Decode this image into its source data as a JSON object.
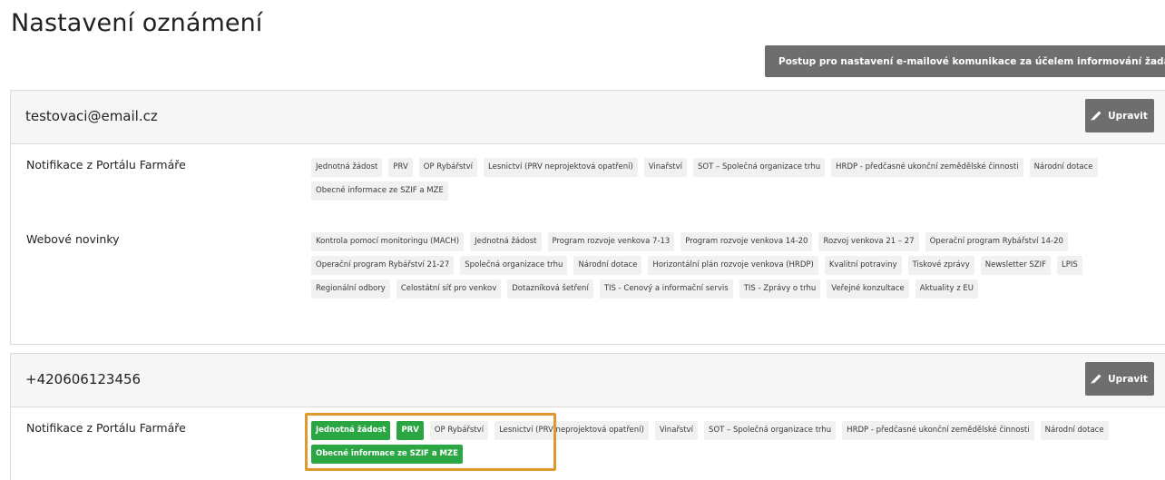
{
  "page": {
    "title": "Nastavení oznámení"
  },
  "guide_button": {
    "label": "Postup pro nastavení e-mailové komunikace za účelem informování žadatele",
    "icon": "document-icon"
  },
  "colors": {
    "button_bg": "#6e6e6e",
    "tag_bg": "#f1f1f1",
    "selected_tag_bg": "#2aa743",
    "highlight": "#e0992c"
  },
  "cards": [
    {
      "title": "testovaci@email.cz",
      "edit_label": "Upravit",
      "rows": [
        {
          "label": "Notifikace z Portálu Farmáře",
          "tags": [
            {
              "text": "Jednotná žádost",
              "selected": false
            },
            {
              "text": "PRV",
              "selected": false
            },
            {
              "text": "OP Rybářství",
              "selected": false
            },
            {
              "text": "Lesnictví (PRV neprojektová opatření)",
              "selected": false
            },
            {
              "text": "Vinařství",
              "selected": false
            },
            {
              "text": "SOT – Společná organizace trhu",
              "selected": false
            },
            {
              "text": "HRDP - předčasné ukonční zemědělské činnosti",
              "selected": false
            },
            {
              "text": "Národní dotace",
              "selected": false
            },
            {
              "text": "Obecné informace ze SZIF a MZE",
              "selected": false
            }
          ]
        },
        {
          "label": "Webové novinky",
          "tags": [
            {
              "text": "Kontrola pomocí monitoringu (MACH)",
              "selected": false
            },
            {
              "text": "Jednotná žádost",
              "selected": false
            },
            {
              "text": "Program rozvoje venkova 7-13",
              "selected": false
            },
            {
              "text": "Program rozvoje venkova 14-20",
              "selected": false
            },
            {
              "text": "Rozvoj venkova 21 – 27",
              "selected": false
            },
            {
              "text": "Operační program Rybářství 14-20",
              "selected": false
            },
            {
              "text": "Operační program Rybářství 21-27",
              "selected": false
            },
            {
              "text": "Společná organizace trhu",
              "selected": false
            },
            {
              "text": "Národní dotace",
              "selected": false
            },
            {
              "text": "Horizontální plán rozvoje venkova (HRDP)",
              "selected": false
            },
            {
              "text": "Kvalitní potraviny",
              "selected": false
            },
            {
              "text": "Tiskové zprávy",
              "selected": false
            },
            {
              "text": "Newsletter SZIF",
              "selected": false
            },
            {
              "text": "LPIS",
              "selected": false
            },
            {
              "text": "Regionální odbory",
              "selected": false
            },
            {
              "text": "Celostátní síť pro venkov",
              "selected": false
            },
            {
              "text": "Dotazníková šetření",
              "selected": false
            },
            {
              "text": "TIS - Cenový a informační servis",
              "selected": false
            },
            {
              "text": "TIS - Zprávy o trhu",
              "selected": false
            },
            {
              "text": "Veřejné konzultace",
              "selected": false
            },
            {
              "text": "Aktuality z EU",
              "selected": false
            }
          ]
        }
      ]
    },
    {
      "title": "+420606123456",
      "edit_label": "Upravit",
      "rows": [
        {
          "label": "Notifikace z Portálu Farmáře",
          "tags": [
            {
              "text": "Jednotná žádost",
              "selected": true
            },
            {
              "text": "PRV",
              "selected": true
            },
            {
              "text": "OP Rybářství",
              "selected": false
            },
            {
              "text": "Lesnictví (PRV neprojektová opatření)",
              "selected": false
            },
            {
              "text": "Vinařství",
              "selected": false
            },
            {
              "text": "SOT – Společná organizace trhu",
              "selected": false
            },
            {
              "text": "HRDP - předčasné ukonční zemědělské činnosti",
              "selected": false
            },
            {
              "text": "Národní dotace",
              "selected": false
            },
            {
              "text": "Obecné informace ze SZIF a MZE",
              "selected": true
            }
          ]
        }
      ]
    }
  ]
}
